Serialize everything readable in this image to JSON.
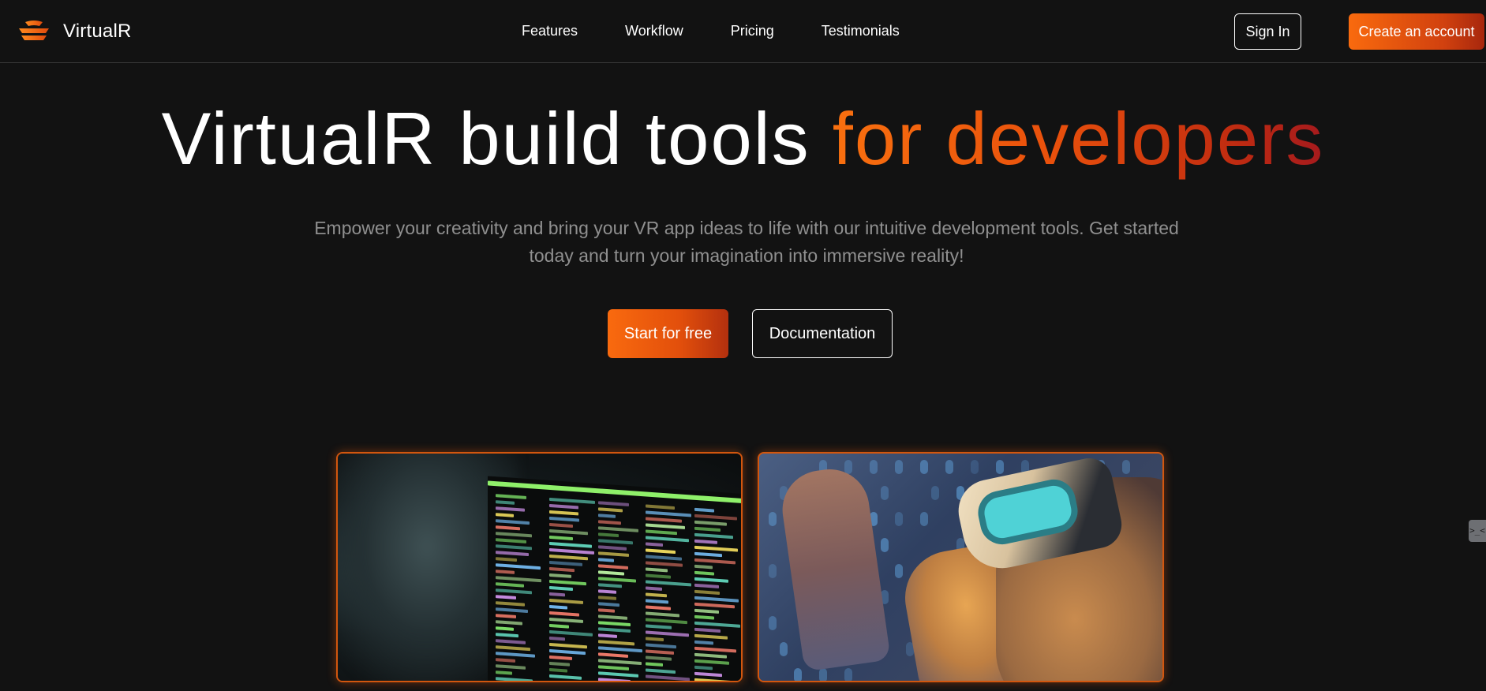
{
  "brand": {
    "name": "VirtualR",
    "logo_icon": "layered-stack-logo-icon",
    "accent": "#f96a0e"
  },
  "nav": {
    "links": [
      "Features",
      "Workflow",
      "Pricing",
      "Testimonials"
    ],
    "sign_in_label": "Sign In",
    "create_account_label": "Create an account"
  },
  "hero": {
    "title_plain": "VirtualR build tools ",
    "title_accent": "for developers",
    "subtitle": "Empower your creativity and bring your VR app ideas to life with our intuitive development tools. Get started today and turn your imagination into immersive reality!",
    "start_label": "Start for free",
    "docs_label": "Documentation"
  },
  "images": [
    {
      "name": "developer-terminal-image",
      "subject": "person looking at terminal screen"
    },
    {
      "name": "vr-headset-image",
      "subject": "person wearing VR headset"
    }
  ],
  "side_tab": {
    "label": ">_<",
    "icon": "console-toggle-icon"
  },
  "colors": {
    "background": "#121212",
    "orange": "#f96a0e",
    "red": "#a51a1d",
    "muted_text": "#8f8f8f"
  }
}
